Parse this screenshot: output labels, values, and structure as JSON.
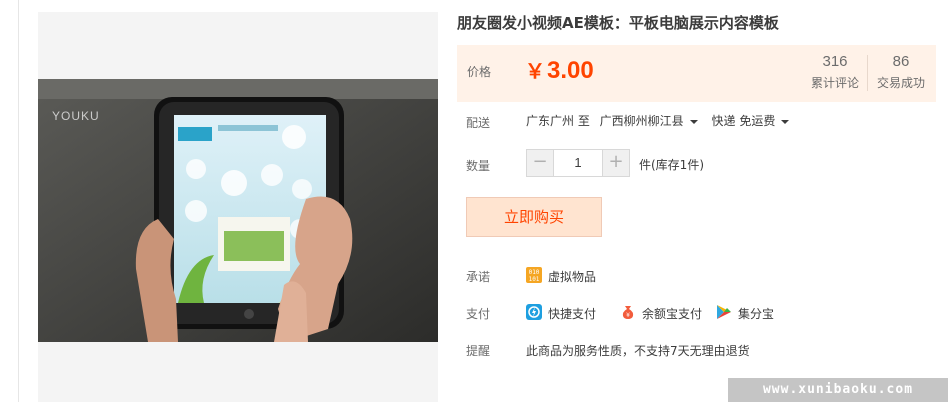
{
  "product": {
    "title": "朋友圈发小视频AE模板：平板电脑展示内容模板"
  },
  "media": {
    "video_watermark": "YOUKU"
  },
  "price": {
    "label": "价格",
    "currency": "￥",
    "amount": "3.00",
    "accent_color": "#ff4400",
    "panel_color": "#fff2e8"
  },
  "stats": {
    "reviews_count": "316",
    "reviews_label": "累计评论",
    "deals_count": "86",
    "deals_label": "交易成功"
  },
  "shipping": {
    "label": "配送",
    "origin": "广东广州 至",
    "destination": "广西柳州柳江县",
    "method": "快递 免运费"
  },
  "quantity": {
    "label": "数量",
    "minus": "−",
    "value": "1",
    "plus": "+",
    "stock_text": "件(库存1件)"
  },
  "buy_button": {
    "label": "立即购买"
  },
  "promise": {
    "label": "承诺",
    "item": "虚拟物品",
    "icon": "virtual-goods-icon"
  },
  "payment": {
    "label": "支付",
    "methods": [
      {
        "name": "快捷支付",
        "icon": "quick-pay-icon"
      },
      {
        "name": "余额宝支付",
        "icon": "yuebao-icon"
      },
      {
        "name": "集分宝",
        "icon": "jifenbao-icon"
      }
    ]
  },
  "reminder": {
    "label": "提醒",
    "text": "此商品为服务性质，不支持7天无理由退货"
  },
  "site_watermark": "www.xunibaoku.com"
}
